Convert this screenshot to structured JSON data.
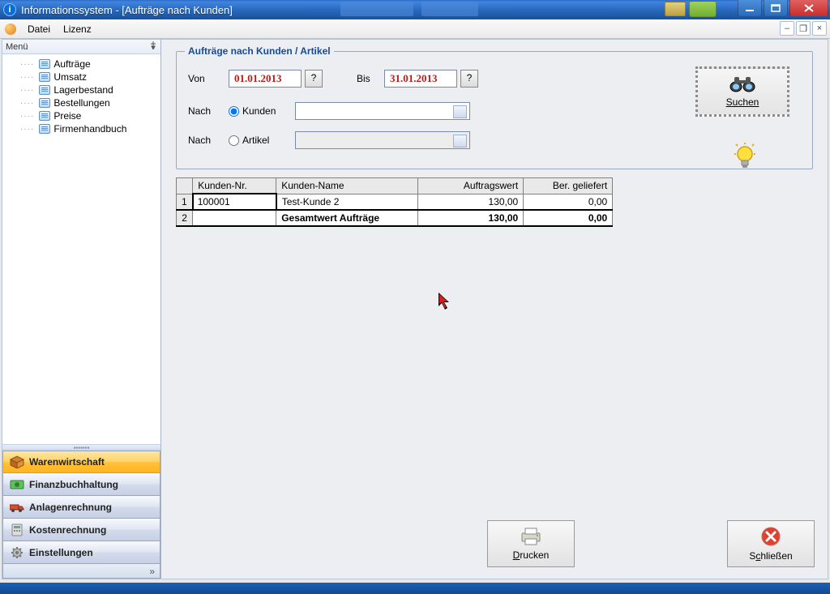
{
  "title": "Informationssystem - [Aufträge nach Kunden]",
  "menubar": {
    "datei": "Datei",
    "lizenz": "Lizenz"
  },
  "sidebar": {
    "header": "Menü",
    "tree": [
      "Aufträge",
      "Umsatz",
      "Lagerbestand",
      "Bestellungen",
      "Preise",
      "Firmenhandbuch"
    ],
    "nav": [
      {
        "label": "Warenwirtschaft",
        "active": true
      },
      {
        "label": "Finanzbuchhaltung",
        "active": false
      },
      {
        "label": "Anlagenrechnung",
        "active": false
      },
      {
        "label": "Kostenrechnung",
        "active": false
      },
      {
        "label": "Einstellungen",
        "active": false
      }
    ]
  },
  "filter": {
    "legend": "Aufträge nach Kunden / Artikel",
    "von_label": "Von",
    "von_value": "01.01.2013",
    "bis_label": "Bis",
    "bis_value": "31.01.2013",
    "nach_label": "Nach",
    "kunden_label": "Kunden",
    "artikel_label": "Artikel",
    "search": "Suchen",
    "q": "?"
  },
  "table": {
    "columns": [
      "Kunden-Nr.",
      "Kunden-Name",
      "Auftragswert",
      "Ber. geliefert"
    ],
    "rows": [
      {
        "n": "1",
        "nr": "100001",
        "name": "Test-Kunde 2",
        "wert": "130,00",
        "gel": "0,00"
      }
    ],
    "total": {
      "n": "2",
      "label": "Gesamtwert Aufträge",
      "wert": "130,00",
      "gel": "0,00"
    }
  },
  "buttons": {
    "print": "Drucken",
    "close": "Schließen"
  }
}
